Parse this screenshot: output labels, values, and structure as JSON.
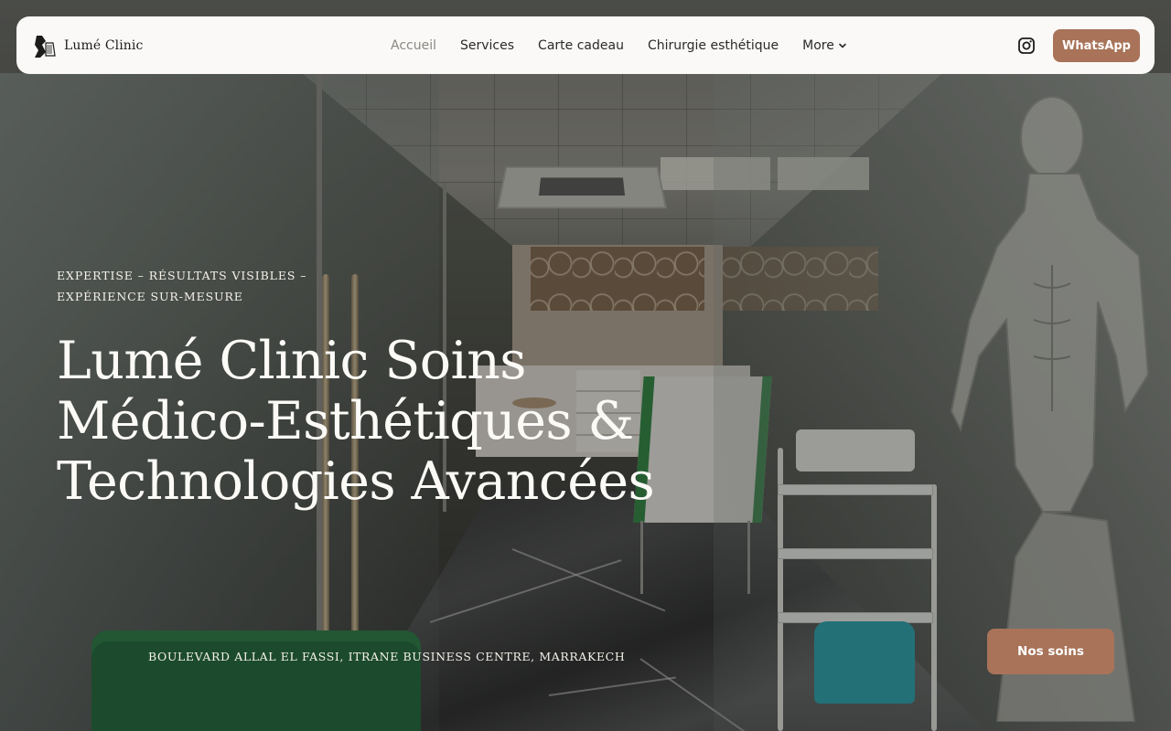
{
  "brand": {
    "name": "Lumé Clinic",
    "logo_icon": "lume-logo-mark"
  },
  "nav": {
    "items": [
      {
        "label": "Accueil",
        "active": true
      },
      {
        "label": "Services",
        "active": false
      },
      {
        "label": "Carte cadeau",
        "active": false
      },
      {
        "label": "Chirurgie esthétique",
        "active": false
      },
      {
        "label": "More",
        "active": false,
        "icon": "chevron-down-icon"
      }
    ],
    "social_icon": "instagram-icon",
    "whatsapp_label": "WhatsApp"
  },
  "hero": {
    "eyebrow": "EXPERTISE – RÉSULTATS VISIBLES – EXPÉRIENCE SUR-MESURE",
    "headline": "Lumé Clinic Soins Médico-Esthétiques & Technologies Avancées",
    "address": "BOULEVARD ALLAL EL FASSI, ITRANE BUSINESS CENTRE, MARRAKECH",
    "cta_label": "Nos soins"
  },
  "colors": {
    "accent": "#a87359",
    "nav_background": "#faf9f7",
    "active_link": "#8a8884",
    "hero_text": "#fbfaf7"
  }
}
